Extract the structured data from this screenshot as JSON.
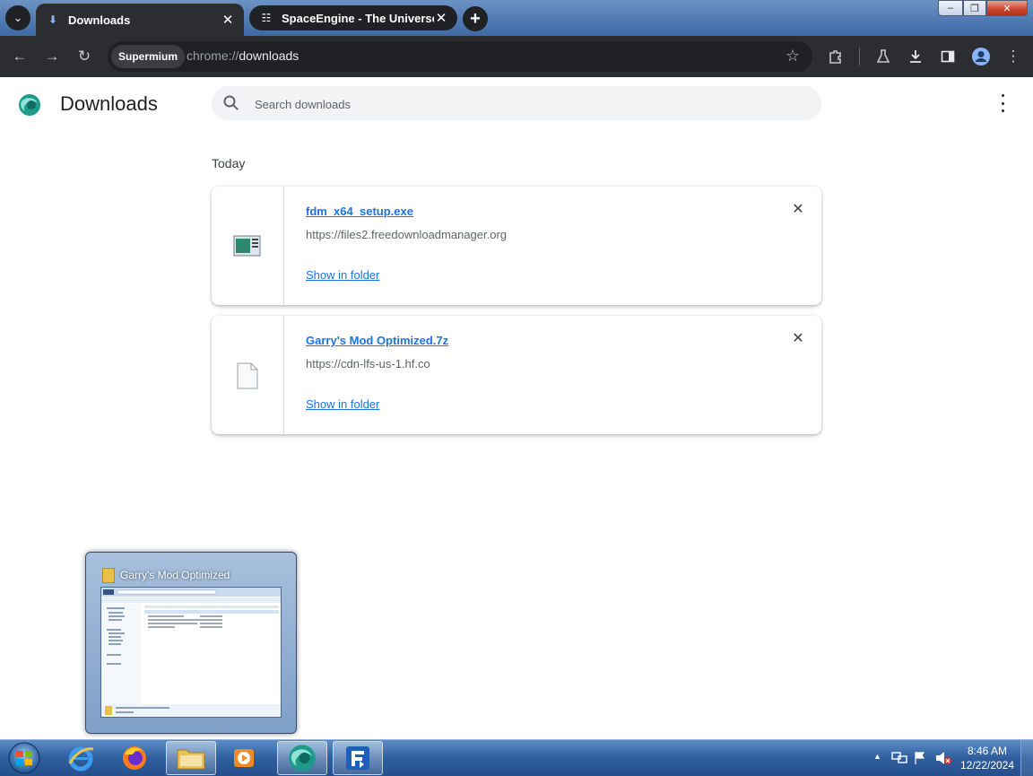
{
  "browser": {
    "tabs": [
      {
        "label": "Downloads",
        "icon": "download-icon",
        "active": true
      },
      {
        "label": "SpaceEngine - The Universe Si",
        "icon": "spaceengine-icon",
        "active": false
      }
    ],
    "profile_chip": "Supermium",
    "url_scheme": "chrome://",
    "url_host": "downloads"
  },
  "page": {
    "title": "Downloads",
    "search_placeholder": "Search downloads",
    "section_label": "Today",
    "downloads": [
      {
        "filename": "fdm_x64_setup.exe",
        "url": "https://files2.freedownloadmanager.org",
        "action": "Show in folder",
        "icon": "installer-file-icon"
      },
      {
        "filename": "Garry's Mod Optimized.7z",
        "url": "https://cdn-lfs-us-1.hf.co",
        "action": "Show in folder",
        "icon": "generic-file-icon"
      }
    ]
  },
  "preview": {
    "title": "Garry's Mod Optimized"
  },
  "taskbar": {
    "time": "8:46 AM",
    "date": "12/22/2024"
  },
  "colors": {
    "accent": "#1a73e8",
    "toolbar": "#2b2d31",
    "taskbar": "#2f5e9e"
  }
}
